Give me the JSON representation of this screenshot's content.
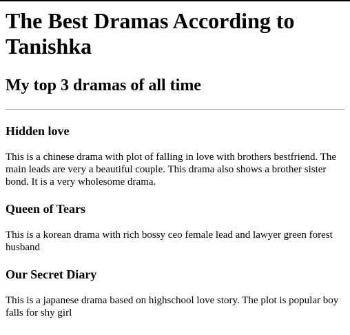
{
  "page": {
    "title": "The Best Dramas According to Tanishka",
    "subtitle": "My top 3 dramas of all time"
  },
  "dramas": [
    {
      "name": "Hidden love",
      "description": "This is a chinese drama with plot of falling in love with brothers bestfriend. The main leads are very a beautiful couple. This drama also shows a brother sister bond. It is a very wholesome drama."
    },
    {
      "name": "Queen of Tears",
      "description": "This is a korean drama with rich bossy ceo female lead and lawyer green forest husband"
    },
    {
      "name": "Our Secret Diary",
      "description": "This is a japanese drama based on highschool love story. The plot is popular boy falls for shy girl"
    }
  ]
}
